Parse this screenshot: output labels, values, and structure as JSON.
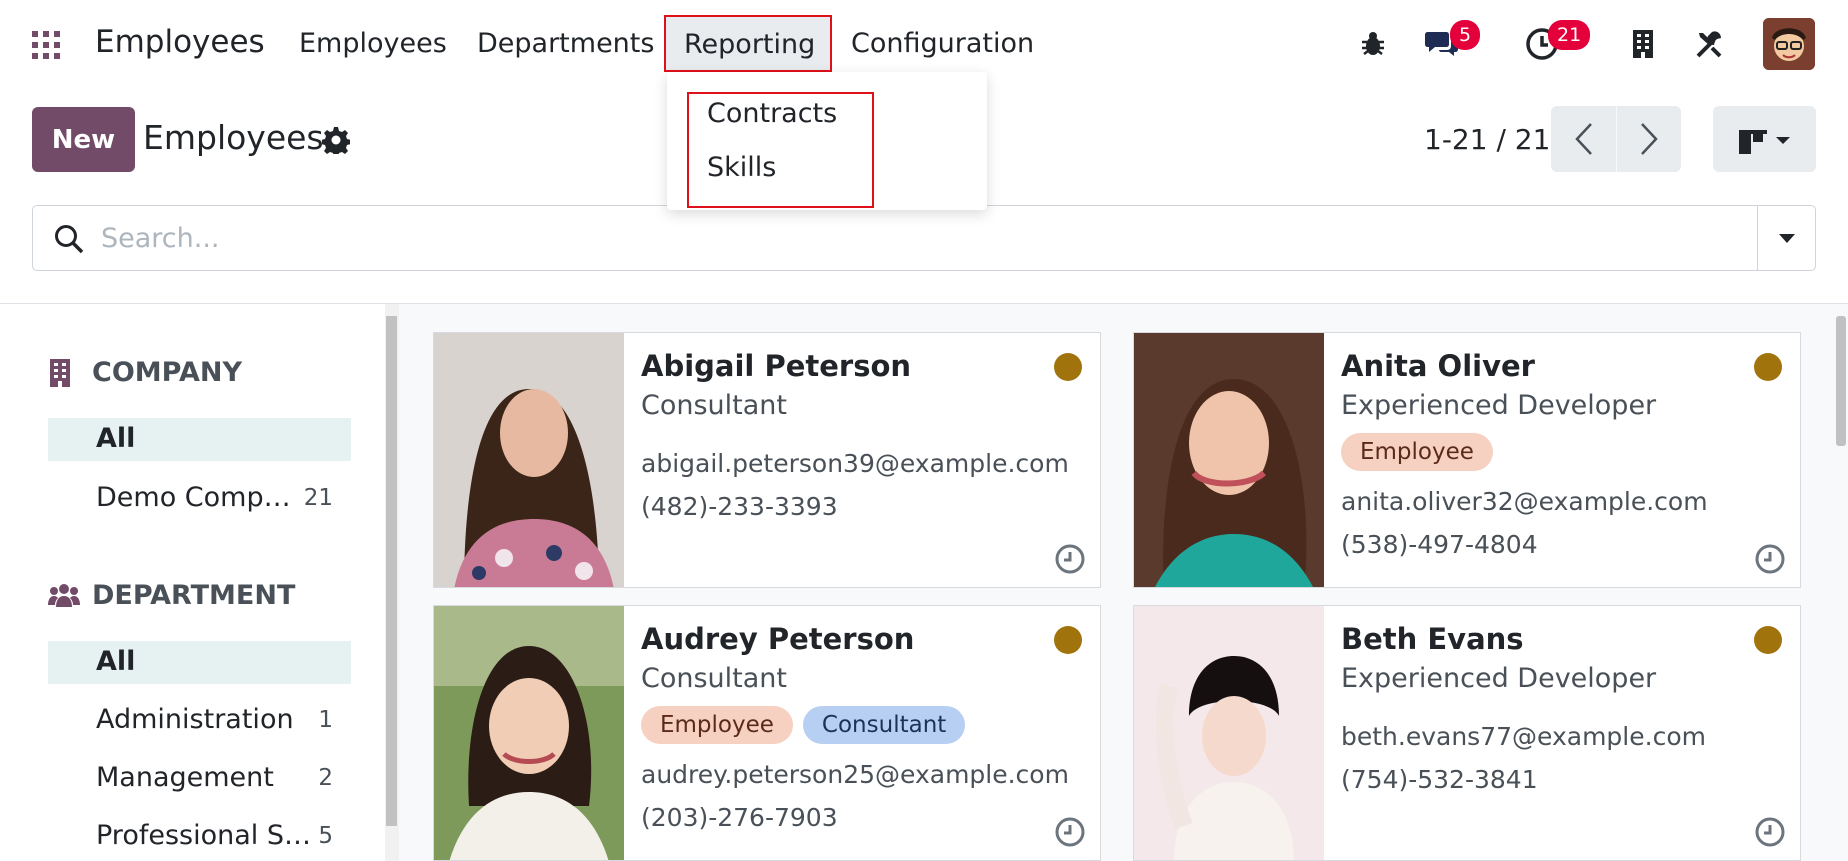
{
  "navbar": {
    "app_title": "Employees",
    "menu": [
      "Employees",
      "Departments",
      "Reporting",
      "Configuration"
    ],
    "messages_count": "5",
    "activities_count": "21",
    "accent": "#714b67"
  },
  "dropdown": {
    "items": [
      "Contracts",
      "Skills"
    ]
  },
  "control": {
    "new_label": "New",
    "title": "Employees",
    "pager": "1-21 / 21"
  },
  "search": {
    "placeholder": "Search..."
  },
  "sidebar": {
    "company_heading": "COMPANY",
    "company_items": [
      {
        "label": "All",
        "count": ""
      },
      {
        "label": "Demo Comp…",
        "count": "21"
      }
    ],
    "department_heading": "DEPARTMENT",
    "department_items": [
      {
        "label": "All",
        "count": ""
      },
      {
        "label": "Administration",
        "count": "1"
      },
      {
        "label": "Management",
        "count": "2"
      },
      {
        "label": "Professional S…",
        "count": "5"
      }
    ]
  },
  "employees": [
    {
      "name": "Abigail Peterson",
      "job": "Consultant",
      "tags": [],
      "email": "abigail.peterson39@example.com",
      "phone": "(482)-233-3393"
    },
    {
      "name": "Anita Oliver",
      "job": "Experienced Developer",
      "tags": [
        "Employee"
      ],
      "email": "anita.oliver32@example.com",
      "phone": "(538)-497-4804"
    },
    {
      "name": "Audrey Peterson",
      "job": "Consultant",
      "tags": [
        "Employee",
        "Consultant"
      ],
      "email": "audrey.peterson25@example.com",
      "phone": "(203)-276-7903"
    },
    {
      "name": "Beth Evans",
      "job": "Experienced Developer",
      "tags": [],
      "email": "beth.evans77@example.com",
      "phone": "(754)-532-3841"
    }
  ]
}
